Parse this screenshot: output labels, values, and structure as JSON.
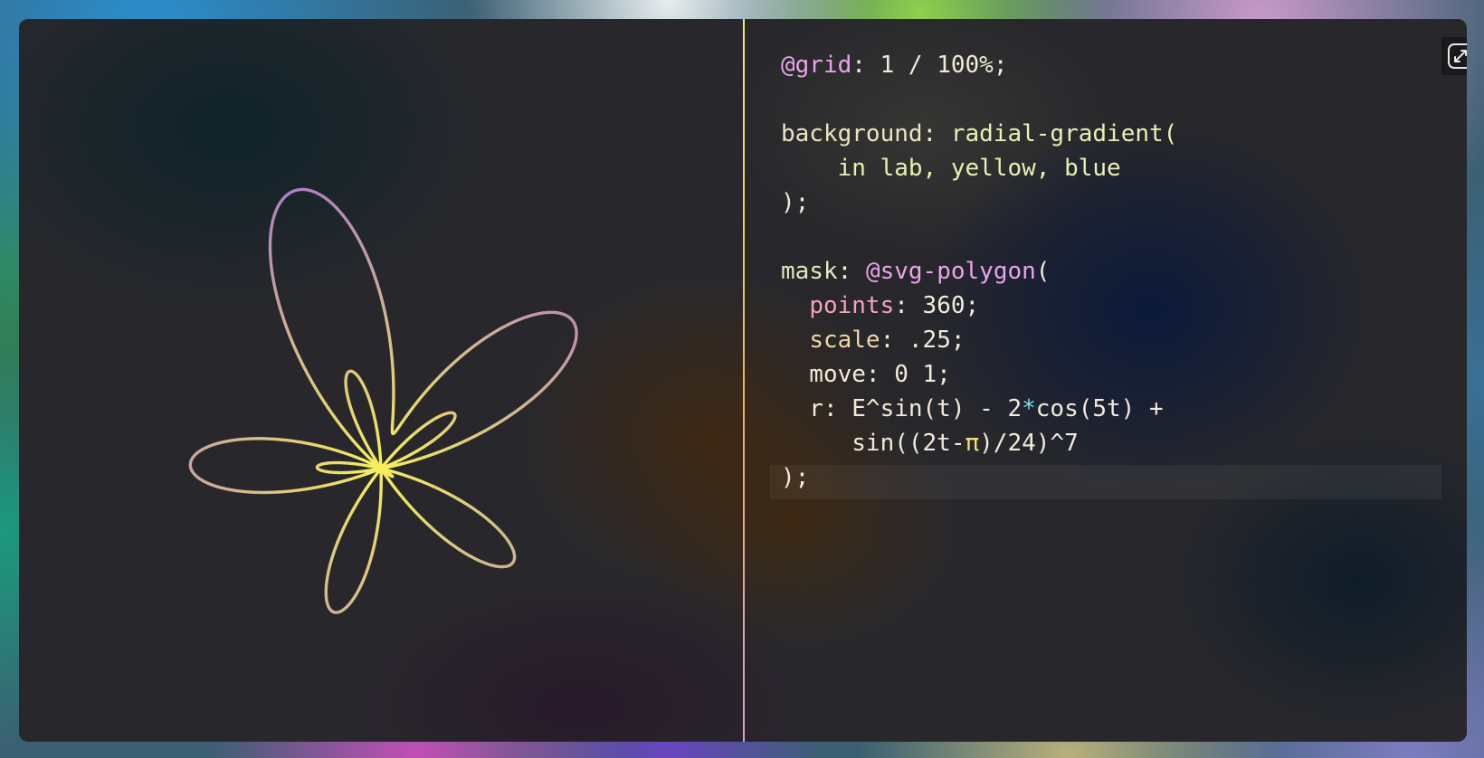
{
  "preview": {
    "curve_formula": "r = E^sin(t) - 2*cos(5t) + sin((2t-π)/24)^7",
    "gradient_colors": [
      "#f7f05a",
      "#b07fc0"
    ]
  },
  "toolbar": {
    "expand_icon": "expand-arrows-icon"
  },
  "editor": {
    "lines": [
      [
        {
          "t": "@grid",
          "c": "atrule"
        },
        {
          "t": ": 1 / 100%;",
          "c": "val"
        }
      ],
      [],
      [
        {
          "t": "background",
          "c": "prop"
        },
        {
          "t": ": ",
          "c": "val"
        },
        {
          "t": "radial-gradient(",
          "c": "fn"
        }
      ],
      [
        {
          "t": "    in lab, yellow, blue",
          "c": "fn"
        }
      ],
      [
        {
          "t": ");",
          "c": "val"
        }
      ],
      [],
      [
        {
          "t": "mask",
          "c": "prop"
        },
        {
          "t": ": ",
          "c": "val"
        },
        {
          "t": "@svg-polygon",
          "c": "atrule"
        },
        {
          "t": "(",
          "c": "val"
        }
      ],
      [
        {
          "t": "  ",
          "c": "val"
        },
        {
          "t": "points",
          "c": "prop-pink"
        },
        {
          "t": ": 360;",
          "c": "val"
        }
      ],
      [
        {
          "t": "  ",
          "c": "val"
        },
        {
          "t": "scale",
          "c": "prop-gold"
        },
        {
          "t": ": .25;",
          "c": "val"
        }
      ],
      [
        {
          "t": "  move: 0 1;",
          "c": "val"
        }
      ],
      [
        {
          "t": "  r: E^sin(t) - 2",
          "c": "val"
        },
        {
          "t": "*",
          "c": "op"
        },
        {
          "t": "cos(5t) +",
          "c": "val"
        }
      ],
      [
        {
          "t": "     sin((2t-",
          "c": "val"
        },
        {
          "t": "π",
          "c": "pi"
        },
        {
          "t": ")/24)^7",
          "c": "val"
        }
      ],
      [
        {
          "t": ");",
          "c": "val"
        }
      ]
    ],
    "active_line": 13
  },
  "colors": {
    "divider": "#f1eb6a",
    "keyword": "#e7a6e9",
    "operator": "#7fdde6"
  }
}
